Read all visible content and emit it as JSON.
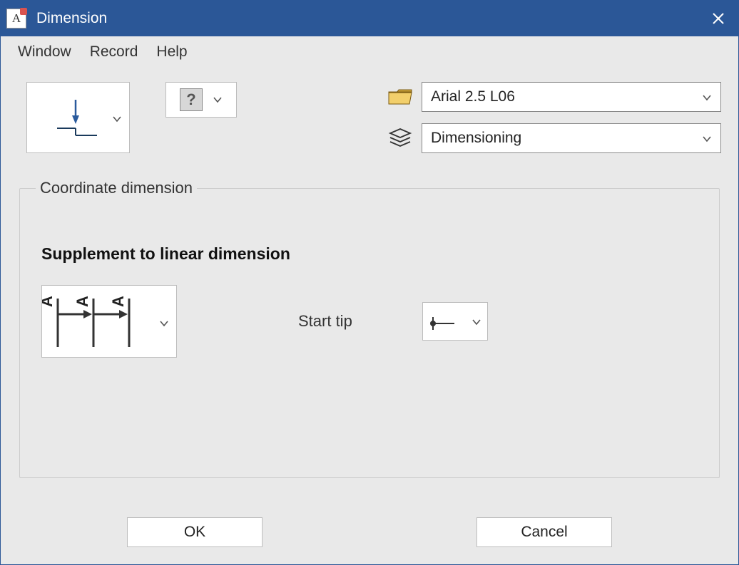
{
  "title": "Dimension",
  "titlebar_icon_letter": "A",
  "menu": {
    "window": "Window",
    "record": "Record",
    "help": "Help"
  },
  "toolbar": {
    "font_combo": "Arial 2.5 L06",
    "layer_combo": "Dimensioning"
  },
  "group": {
    "legend": "Coordinate dimension",
    "heading": "Supplement to linear dimension",
    "start_tip_label": "Start tip"
  },
  "footer": {
    "ok": "OK",
    "cancel": "Cancel"
  }
}
